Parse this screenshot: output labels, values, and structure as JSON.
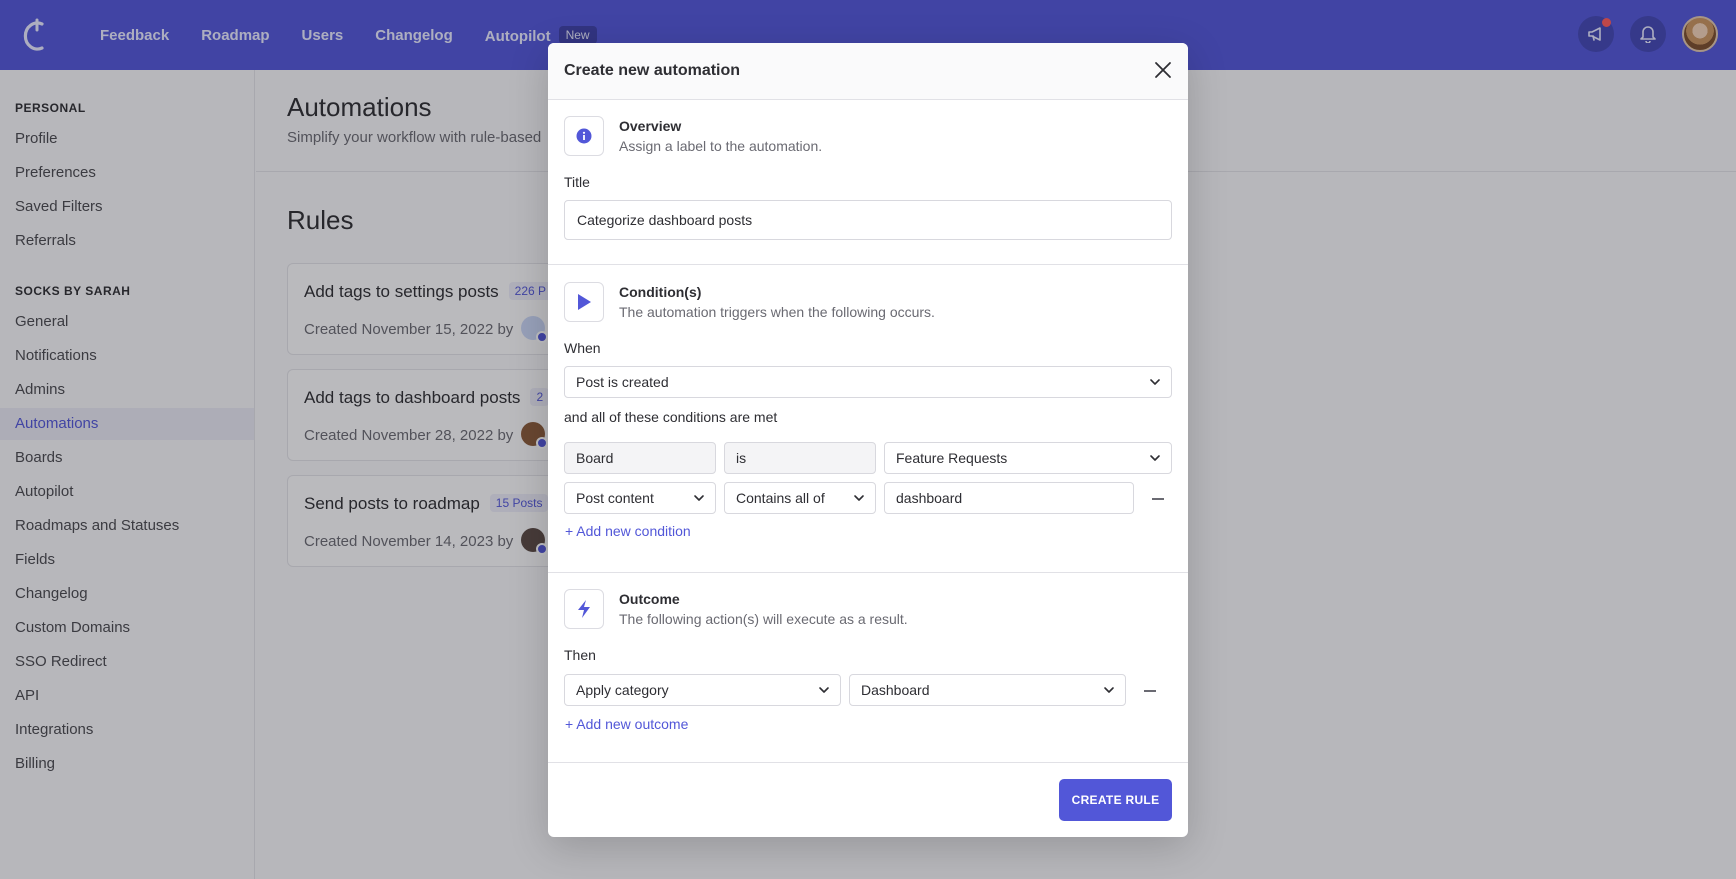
{
  "nav": {
    "items": [
      "Feedback",
      "Roadmap",
      "Users",
      "Changelog",
      "Autopilot"
    ],
    "autopilot_badge": "New"
  },
  "sidebar": {
    "personal_header": "PERSONAL",
    "personal_items": [
      "Profile",
      "Preferences",
      "Saved Filters",
      "Referrals"
    ],
    "company_header": "SOCKS BY SARAH",
    "company_items": [
      "General",
      "Notifications",
      "Admins",
      "Automations",
      "Boards",
      "Autopilot",
      "Roadmaps and Statuses",
      "Fields",
      "Changelog",
      "Custom Domains",
      "SSO Redirect",
      "API",
      "Integrations",
      "Billing"
    ],
    "active_item": "Automations"
  },
  "page": {
    "title": "Automations",
    "subtitle": "Simplify your workflow with rule-based",
    "rules_title": "Rules"
  },
  "rules": [
    {
      "name": "Add tags to settings posts",
      "count": "226 P",
      "meta": "Created November 15, 2022 by"
    },
    {
      "name": "Add tags to dashboard posts",
      "count": "2",
      "meta": "Created November 28, 2022 by"
    },
    {
      "name": "Send posts to roadmap",
      "count": "15 Posts",
      "meta": "Created November 14, 2023 by"
    }
  ],
  "modal": {
    "title": "Create new automation",
    "overview": {
      "title": "Overview",
      "desc": "Assign a label to the automation.",
      "field_label": "Title",
      "title_value": "Categorize dashboard posts"
    },
    "conditions": {
      "title": "Condition(s)",
      "desc": "The automation triggers when the following occurs.",
      "when_label": "When",
      "when_value": "Post is created",
      "and_label": "and all of these conditions are met",
      "row1": {
        "field": "Board",
        "operator": "is",
        "value": "Feature Requests"
      },
      "row2": {
        "field": "Post content",
        "operator": "Contains all of",
        "value": "dashboard"
      },
      "add_link": "+ Add new condition"
    },
    "outcome": {
      "title": "Outcome",
      "desc": "The following action(s) will execute as a result.",
      "then_label": "Then",
      "action": "Apply category",
      "action_value": "Dashboard",
      "add_link": "+ Add new outcome"
    },
    "submit_label": "CREATE RULE"
  },
  "colors": {
    "brand": "#5257d8",
    "notification_dot": "#ff5a5a"
  }
}
